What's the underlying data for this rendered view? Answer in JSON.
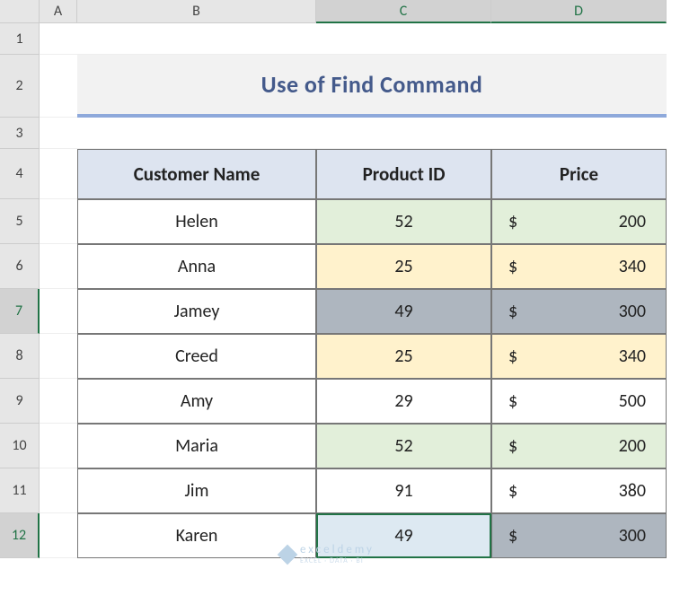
{
  "colHeaders": [
    "A",
    "B",
    "C",
    "D"
  ],
  "rowHeaders": [
    "1",
    "2",
    "3",
    "4",
    "5",
    "6",
    "7",
    "8",
    "9",
    "10",
    "11",
    "12"
  ],
  "title": "Use of Find Command",
  "table": {
    "headers": [
      "Customer Name",
      "Product ID",
      "Price"
    ],
    "rows": [
      {
        "name": "Helen",
        "pid": "52",
        "price": "200",
        "pidFill": "fill-green",
        "priceFill": "fill-green"
      },
      {
        "name": "Anna",
        "pid": "25",
        "price": "340",
        "pidFill": "fill-yellow",
        "priceFill": "fill-yellow"
      },
      {
        "name": "Jamey",
        "pid": "49",
        "price": "300",
        "pidFill": "fill-gray",
        "priceFill": "fill-gray"
      },
      {
        "name": "Creed",
        "pid": "25",
        "price": "340",
        "pidFill": "fill-yellow",
        "priceFill": "fill-yellow"
      },
      {
        "name": "Amy",
        "pid": "29",
        "price": "500",
        "pidFill": "",
        "priceFill": ""
      },
      {
        "name": "Maria",
        "pid": "52",
        "price": "200",
        "pidFill": "fill-green",
        "priceFill": "fill-green"
      },
      {
        "name": "Jim",
        "pid": "91",
        "price": "380",
        "pidFill": "",
        "priceFill": ""
      },
      {
        "name": "Karen",
        "pid": "49",
        "price": "300",
        "pidFill": "fill-blue",
        "priceFill": "fill-gray"
      }
    ]
  },
  "currency": "$",
  "watermark": {
    "main": "exceldemy",
    "sub": "EXCEL · DATA · BI"
  }
}
